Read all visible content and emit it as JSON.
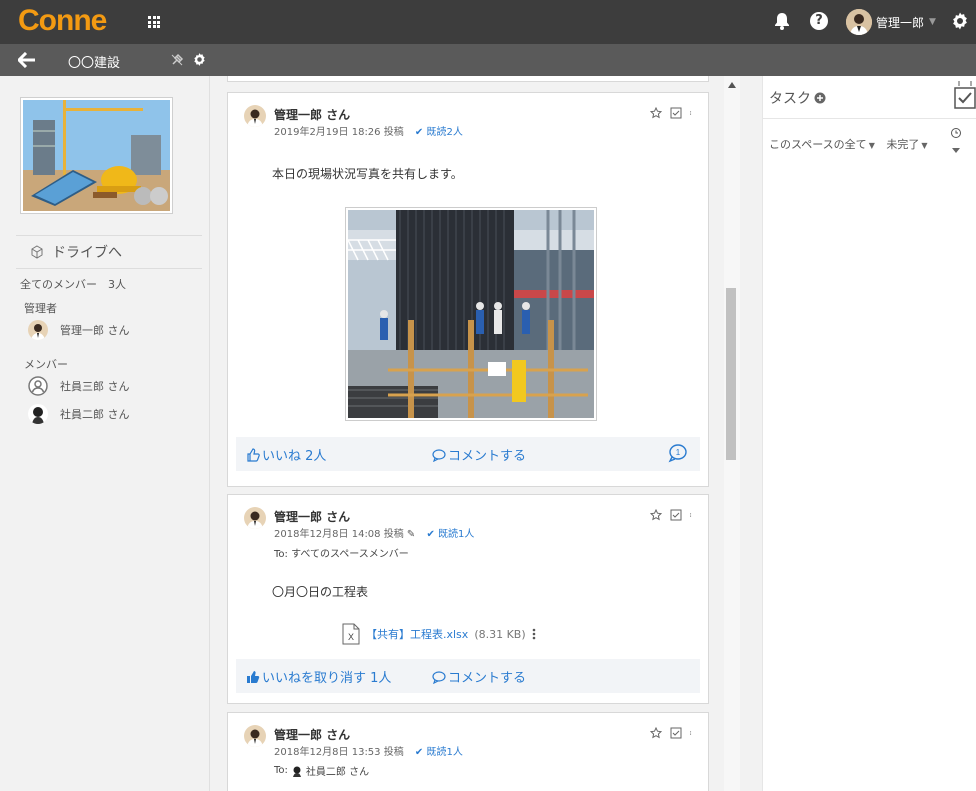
{
  "app": {
    "logo": "Conne"
  },
  "topbar": {
    "user_name": "管理一郎"
  },
  "subbar": {
    "space_name": "〇〇建設"
  },
  "sidebar": {
    "drive_link": "ドライブへ",
    "members_summary": "全てのメンバー　3人",
    "admin_label": "管理者",
    "admins": [
      {
        "name": "管理一郎 さん"
      }
    ],
    "member_label": "メンバー",
    "members": [
      {
        "name": "社員三郎 さん"
      },
      {
        "name": "社員二郎 さん"
      }
    ]
  },
  "feed": {
    "posts": [
      {
        "author": "管理一郎 さん",
        "meta": "2019年2月19日 18:26 投稿",
        "read": "既読2人",
        "body": "本日の現場状況写真を共有します。",
        "like": "いいね 2人",
        "comment": "コメントする"
      },
      {
        "author": "管理一郎 さん",
        "meta": "2018年12月8日 14:08 投稿",
        "read": "既読1人",
        "to": "To: すべてのスペースメンバー",
        "body": "〇月〇日の工程表",
        "file_name": "【共有】工程表.xlsx",
        "file_size": "(8.31 KB)",
        "like": "いいねを取り消す 1人",
        "comment": "コメントする"
      },
      {
        "author": "管理一郎 さん",
        "meta": "2018年12月8日 13:53 投稿",
        "read": "既読1人",
        "to_prefix": "To:",
        "to_name": "社員二郎 さん"
      }
    ]
  },
  "tasks": {
    "title": "タスク",
    "filter_scope": "このスペースの全て",
    "filter_status": "未完了"
  },
  "colors": {
    "accent": "#2a7bd0",
    "brand": "#f39a12",
    "topbar": "#3d3d3d"
  }
}
